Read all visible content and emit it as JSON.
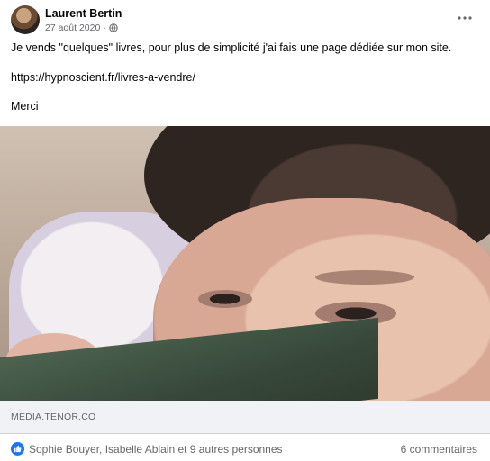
{
  "header": {
    "author": "Laurent Bertin",
    "date": "27 août 2020",
    "separator": "·",
    "audience_icon": "globe-icon",
    "more_icon": "more-horizontal-icon"
  },
  "post": {
    "line1": "Je vends \"quelques\" livres, pour plus de simplicité j'ai fais une page dédiée sur mon site.",
    "link": "https://hypnoscient.fr/livres-a-vendre/",
    "line3": "Merci"
  },
  "media": {
    "source": "MEDIA.TENOR.CO"
  },
  "reactions": {
    "icon": "like-icon",
    "text": "Sophie Bouyer, Isabelle Ablain et 9 autres personnes",
    "comments": "6 commentaires"
  },
  "colors": {
    "accent": "#1877f2",
    "secondary_text": "#65676b",
    "caption_bg": "#f0f2f5"
  }
}
